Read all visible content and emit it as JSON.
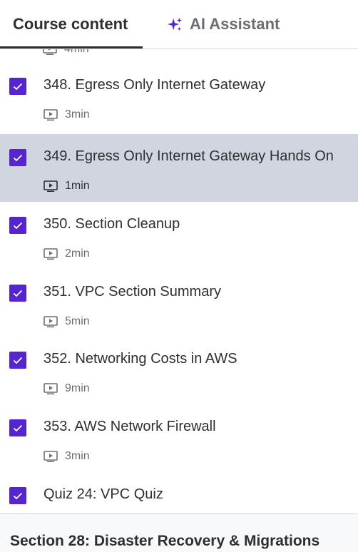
{
  "tabs": {
    "course_content": "Course content",
    "ai_assistant": "AI Assistant"
  },
  "colors": {
    "accent": "#5624d0",
    "active_row": "#d1d5e0"
  },
  "icons": {
    "checkbox": "checkmark-icon",
    "lecture": "video-play-icon",
    "ai": "sparkle-icon"
  },
  "previous_item": {
    "duration": "4min"
  },
  "items": [
    {
      "title": "348. Egress Only Internet Gateway",
      "duration": "3min",
      "completed": true,
      "active": false
    },
    {
      "title": "349. Egress Only Internet Gateway Hands On",
      "duration": "1min",
      "completed": true,
      "active": true
    },
    {
      "title": "350. Section Cleanup",
      "duration": "2min",
      "completed": true,
      "active": false
    },
    {
      "title": "351. VPC Section Summary",
      "duration": "5min",
      "completed": true,
      "active": false
    },
    {
      "title": "352. Networking Costs in AWS",
      "duration": "9min",
      "completed": true,
      "active": false
    },
    {
      "title": "353. AWS Network Firewall",
      "duration": "3min",
      "completed": true,
      "active": false
    }
  ],
  "quiz": {
    "title": "Quiz 24: VPC Quiz",
    "completed": true
  },
  "next_section": {
    "title": "Section 28: Disaster Recovery & Migrations"
  }
}
